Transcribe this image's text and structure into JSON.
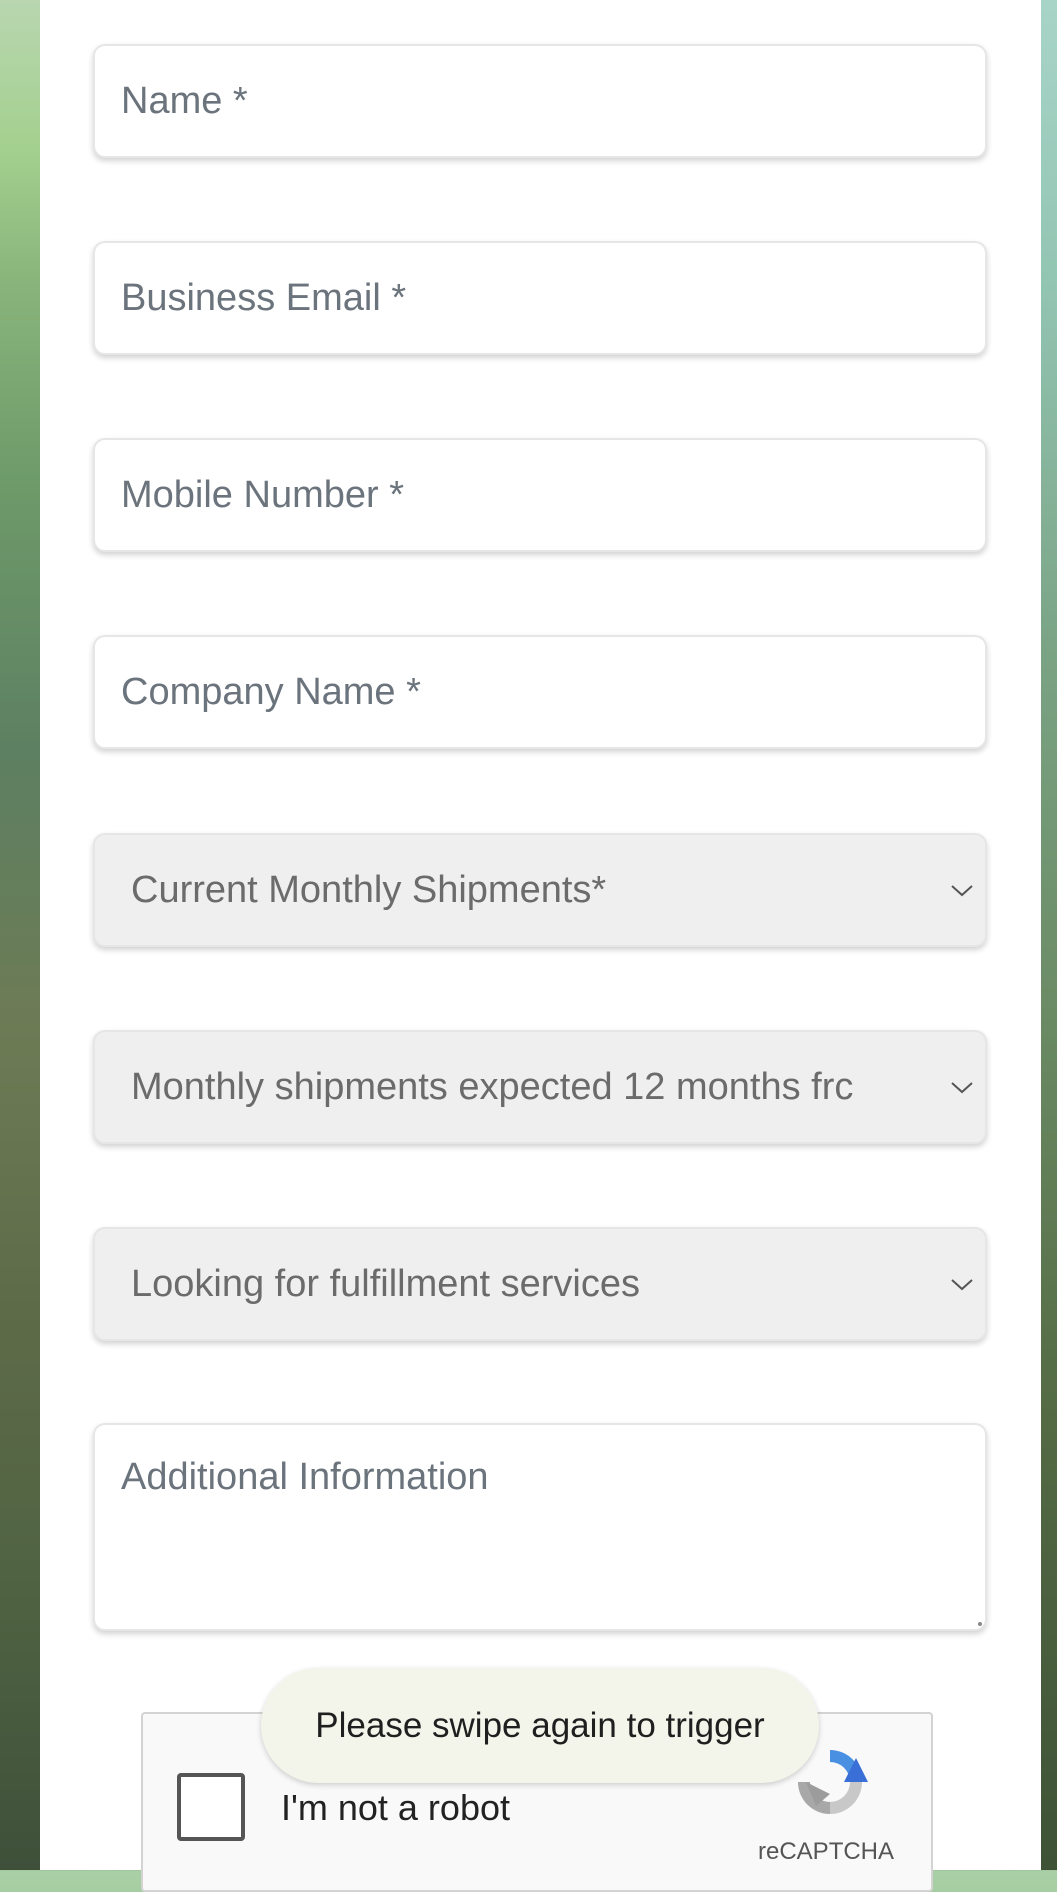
{
  "form": {
    "name_placeholder": "Name *",
    "business_email_placeholder": "Business Email *",
    "mobile_number_placeholder": "Mobile Number *",
    "company_name_placeholder": "Company Name *",
    "current_monthly_shipments": "Current Monthly Shipments*",
    "expected_monthly_shipments": "Monthly shipments expected 12 months frc",
    "fulfillment_services": "Looking for fulfillment services",
    "additional_info_placeholder": "Additional Information"
  },
  "recaptcha": {
    "label": "I'm not a robot",
    "brand": "reCAPTCHA",
    "checked": false
  },
  "toast": {
    "message": "Please swipe again to trigger"
  },
  "colors": {
    "panel_background": "#ffffff",
    "select_background": "#efefef",
    "placeholder_text": "#6b737c",
    "toast_background": "#f3f4ea",
    "recaptcha_blue": "#4a90e2",
    "recaptcha_gray": "#b4b4b4"
  },
  "icons": {
    "dropdown": "chevron-down-icon",
    "captcha_logo": "recaptcha-logo-icon"
  }
}
